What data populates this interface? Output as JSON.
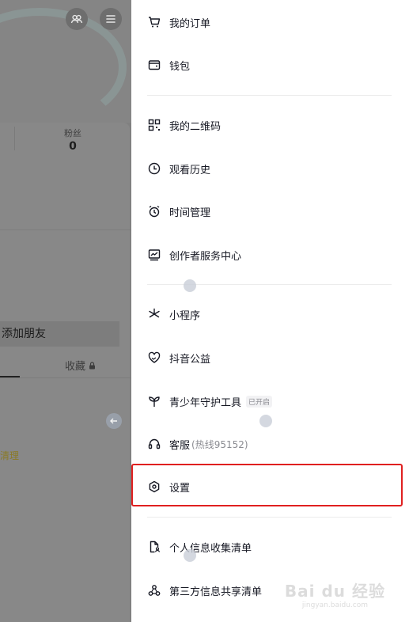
{
  "background": {
    "fans_label": "粉丝",
    "fans_count": "0",
    "add_friend": "添加朋友",
    "tab_favorites": "收藏",
    "clean_link": "清理"
  },
  "menu": {
    "orders": "我的订单",
    "wallet": "钱包",
    "qrcode": "我的二维码",
    "history": "观看历史",
    "time_mgmt": "时间管理",
    "creator": "创作者服务中心",
    "mini_program": "小程序",
    "charity": "抖音公益",
    "youth": "青少年守护工具",
    "youth_badge": "已开启",
    "service": "客服",
    "service_hotline": "(热线95152)",
    "settings": "设置",
    "personal_info": "个人信息收集清单",
    "third_party": "第三方信息共享清单"
  },
  "watermark": {
    "brand": "Bai du 经验",
    "url": "jingyan.baidu.com"
  },
  "colors": {
    "highlight": "#e02020",
    "text": "#161823",
    "muted": "#8a8b91"
  }
}
